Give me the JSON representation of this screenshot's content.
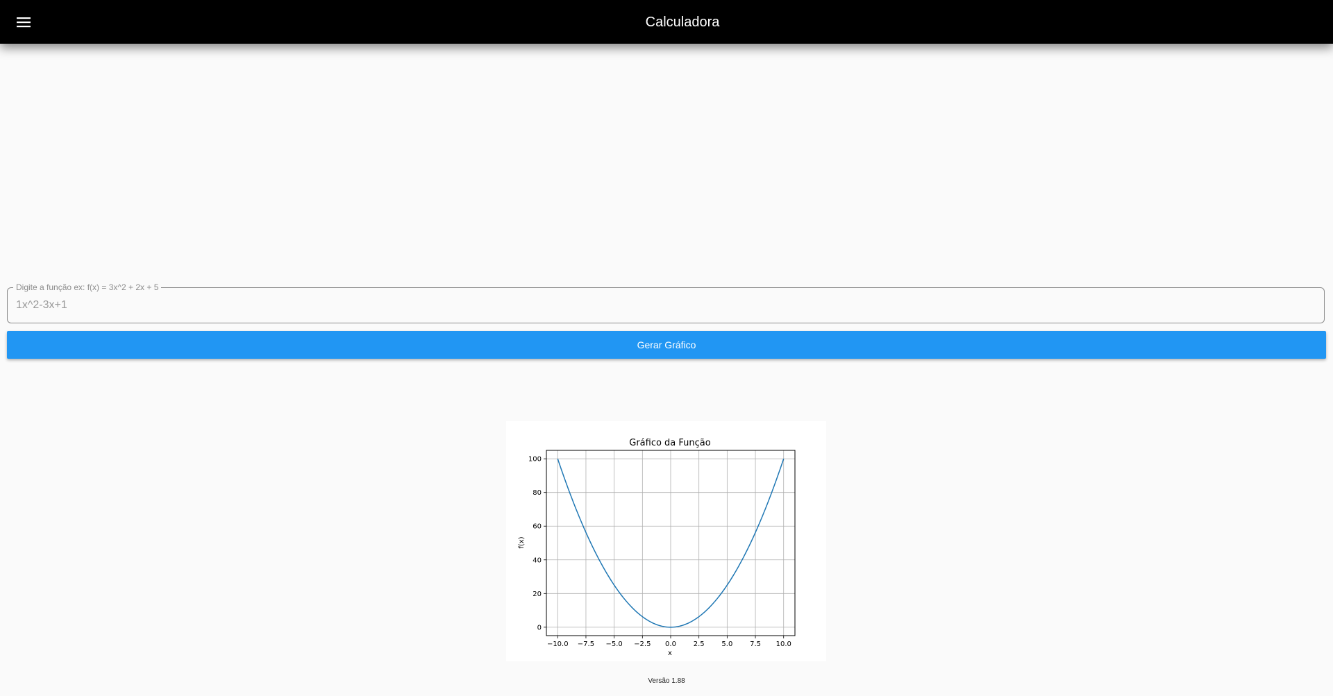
{
  "app": {
    "title": "Calculadora",
    "menu_icon": "menu-icon"
  },
  "input": {
    "label": "Digite a função ex: f(x) = 3x^2 + 2x + 5",
    "value": "1x^2-3x+1"
  },
  "button": {
    "label": "Gerar Gráfico",
    "color": "#2196f3"
  },
  "footer": {
    "version": "Versão 1.88"
  },
  "chart_data": {
    "type": "line",
    "title": "Gráfico da Função",
    "xlabel": "x",
    "ylabel": "f(x)",
    "xlim": [
      -11,
      11
    ],
    "ylim": [
      -5,
      105
    ],
    "xticks": [
      -10.0,
      -7.5,
      -5.0,
      -2.5,
      0.0,
      2.5,
      5.0,
      7.5,
      10.0
    ],
    "xtick_labels": [
      "−10.0",
      "−7.5",
      "−5.0",
      "−2.5",
      "0.0",
      "2.5",
      "5.0",
      "7.5",
      "10.0"
    ],
    "yticks": [
      0,
      20,
      40,
      60,
      80,
      100
    ],
    "ytick_labels": [
      "0",
      "20",
      "40",
      "60",
      "80",
      "100"
    ],
    "grid": true,
    "series": [
      {
        "color": "#1f77b4",
        "x": [
          -10,
          -9,
          -8,
          -7,
          -6,
          -5,
          -4,
          -3,
          -2,
          -1,
          0,
          1,
          2,
          3,
          4,
          5,
          6,
          7,
          8,
          9,
          10
        ],
        "y": [
          100,
          81,
          64,
          49,
          36,
          25,
          16,
          9,
          4,
          1,
          0,
          1,
          4,
          9,
          16,
          25,
          36,
          49,
          64,
          81,
          100
        ]
      }
    ]
  }
}
